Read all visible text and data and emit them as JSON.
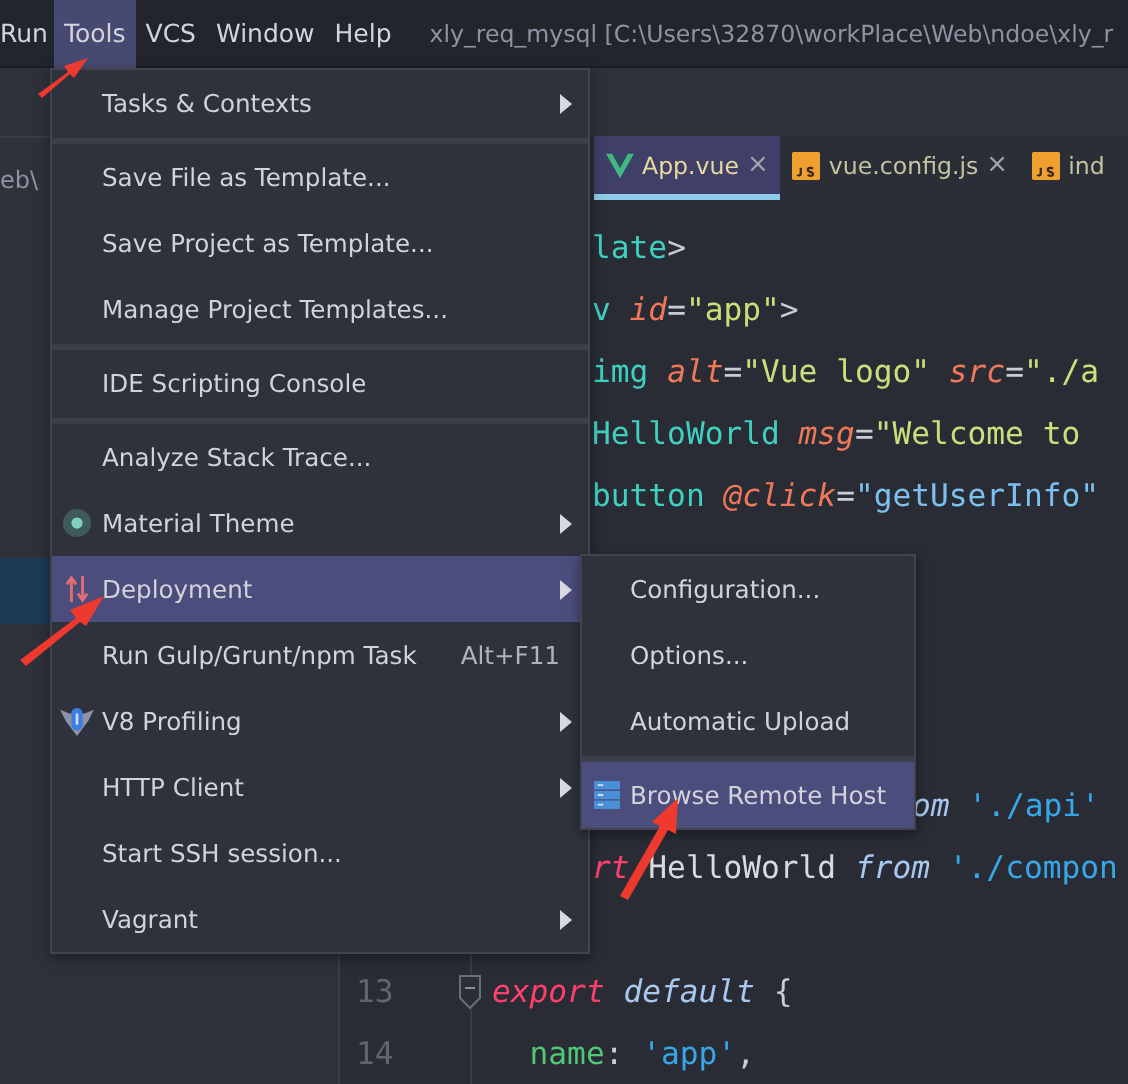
{
  "menubar": {
    "items": [
      {
        "label": "Run",
        "selected": false
      },
      {
        "label": "Tools",
        "selected": true
      },
      {
        "label": "VCS",
        "selected": false
      },
      {
        "label": "Window",
        "selected": false
      },
      {
        "label": "Help",
        "selected": false
      }
    ],
    "title": "xly_req_mysql [C:\\Users\\32870\\workPlace\\Web\\ndoe\\xly_r"
  },
  "side_panel": {
    "path_text": "eb\\"
  },
  "tabs": [
    {
      "label": "App.vue",
      "kind": "vue",
      "selected": true,
      "close": "×"
    },
    {
      "label": "vue.config.js",
      "kind": "js",
      "selected": false,
      "close": "×"
    },
    {
      "label": "ind",
      "kind": "js",
      "selected": false
    }
  ],
  "code_lines": [
    {
      "kind": "clipped",
      "tokens": [
        {
          "text": "late",
          "kind": "tag"
        },
        {
          "text": ">",
          "kind": "punct"
        }
      ]
    },
    {
      "kind": "clipped",
      "tokens": [
        {
          "text": "v ",
          "kind": "tag"
        },
        {
          "text": "id",
          "kind": "attr"
        },
        {
          "text": "=",
          "kind": "punct"
        },
        {
          "text": "\"app\"",
          "kind": "string"
        },
        {
          "text": ">",
          "kind": "punct"
        }
      ]
    },
    {
      "kind": "clipped",
      "tokens": [
        {
          "text": "img ",
          "kind": "tag"
        },
        {
          "text": "alt",
          "kind": "attr"
        },
        {
          "text": "=",
          "kind": "punct"
        },
        {
          "text": "\"Vue logo\" ",
          "kind": "string"
        },
        {
          "text": "src",
          "kind": "attr"
        },
        {
          "text": "=",
          "kind": "punct"
        },
        {
          "text": "\"./a",
          "kind": "string"
        }
      ]
    },
    {
      "kind": "clipped",
      "tokens": [
        {
          "text": "HelloWorld ",
          "kind": "tag"
        },
        {
          "text": "msg",
          "kind": "attr"
        },
        {
          "text": "=",
          "kind": "punct"
        },
        {
          "text": "\"Welcome to",
          "kind": "string"
        }
      ]
    },
    {
      "kind": "clipped",
      "tokens": [
        {
          "text": "button ",
          "kind": "tag"
        },
        {
          "text": "@click",
          "kind": "attr"
        },
        {
          "text": "=",
          "kind": "punct"
        },
        {
          "text": "\"getUserInfo\"",
          "kind": "call"
        }
      ]
    },
    {
      "kind": "hidden"
    },
    {
      "kind": "hidden"
    },
    {
      "kind": "hidden"
    },
    {
      "kind": "hidden"
    },
    {
      "kind": "deep",
      "tokens": [
        {
          "text": "om ",
          "kind": "italic"
        },
        {
          "text": "'./api'",
          "kind": "path"
        }
      ]
    },
    {
      "kind": "clipped",
      "tokens": [
        {
          "text": "rt",
          "kind": "keyword"
        },
        {
          "text": " HelloWorld ",
          "kind": "plain"
        },
        {
          "text": "from ",
          "kind": "italic"
        },
        {
          "text": "'./compon",
          "kind": "path"
        }
      ]
    },
    {
      "kind": "hidden"
    },
    {
      "kind": "numbered",
      "number": "13",
      "fold": true,
      "tokens": [
        {
          "text": "export ",
          "kind": "keyword"
        },
        {
          "text": "default",
          "kind": "italic"
        },
        {
          "text": " {",
          "kind": "punct"
        }
      ]
    },
    {
      "kind": "numbered",
      "number": "14",
      "fold": false,
      "tokens": [
        {
          "text": "  name",
          "kind": "prop"
        },
        {
          "text": ": ",
          "kind": "punct"
        },
        {
          "text": "'app'",
          "kind": "path"
        },
        {
          "text": ",",
          "kind": "punct"
        }
      ]
    }
  ],
  "tools_menu": {
    "items": [
      {
        "label": "Tasks & Contexts",
        "kind": "plain",
        "submenu": true,
        "selected": false,
        "separator_before": false
      },
      {
        "label": "Save File as Template...",
        "kind": "plain",
        "submenu": false,
        "selected": false,
        "separator_before": true
      },
      {
        "label": "Save Project as Template...",
        "kind": "plain",
        "submenu": false,
        "selected": false,
        "separator_before": false
      },
      {
        "label": "Manage Project Templates...",
        "kind": "plain",
        "submenu": false,
        "selected": false,
        "separator_before": false
      },
      {
        "label": "IDE Scripting Console",
        "kind": "plain",
        "submenu": false,
        "selected": false,
        "separator_before": true
      },
      {
        "label": "Analyze Stack Trace...",
        "kind": "plain",
        "submenu": false,
        "selected": false,
        "separator_before": true
      },
      {
        "label": "Material Theme",
        "kind": "theme",
        "submenu": true,
        "selected": false,
        "separator_before": false
      },
      {
        "label": "Deployment",
        "kind": "deploy",
        "submenu": true,
        "selected": true,
        "separator_before": false
      },
      {
        "label": "Run Gulp/Grunt/npm Task",
        "kind": "plain",
        "submenu": false,
        "selected": false,
        "separator_before": false,
        "shortcut": "Alt+F11"
      },
      {
        "label": "V8 Profiling",
        "kind": "profiler",
        "submenu": true,
        "selected": false,
        "separator_before": false
      },
      {
        "label": "HTTP Client",
        "kind": "plain",
        "submenu": true,
        "selected": false,
        "separator_before": false
      },
      {
        "label": "Start SSH session...",
        "kind": "plain",
        "submenu": false,
        "selected": false,
        "separator_before": false
      },
      {
        "label": "Vagrant",
        "kind": "plain",
        "submenu": true,
        "selected": false,
        "separator_before": false
      }
    ]
  },
  "deployment_submenu": {
    "items": [
      {
        "label": "Configuration...",
        "kind": "plain",
        "selected": false,
        "separator_before": false
      },
      {
        "label": "Options...",
        "kind": "plain",
        "selected": false,
        "separator_before": false
      },
      {
        "label": "Automatic Upload",
        "kind": "plain",
        "selected": false,
        "separator_before": false
      },
      {
        "label": "Browse Remote Host",
        "kind": "server",
        "selected": true,
        "separator_before": true
      }
    ]
  }
}
